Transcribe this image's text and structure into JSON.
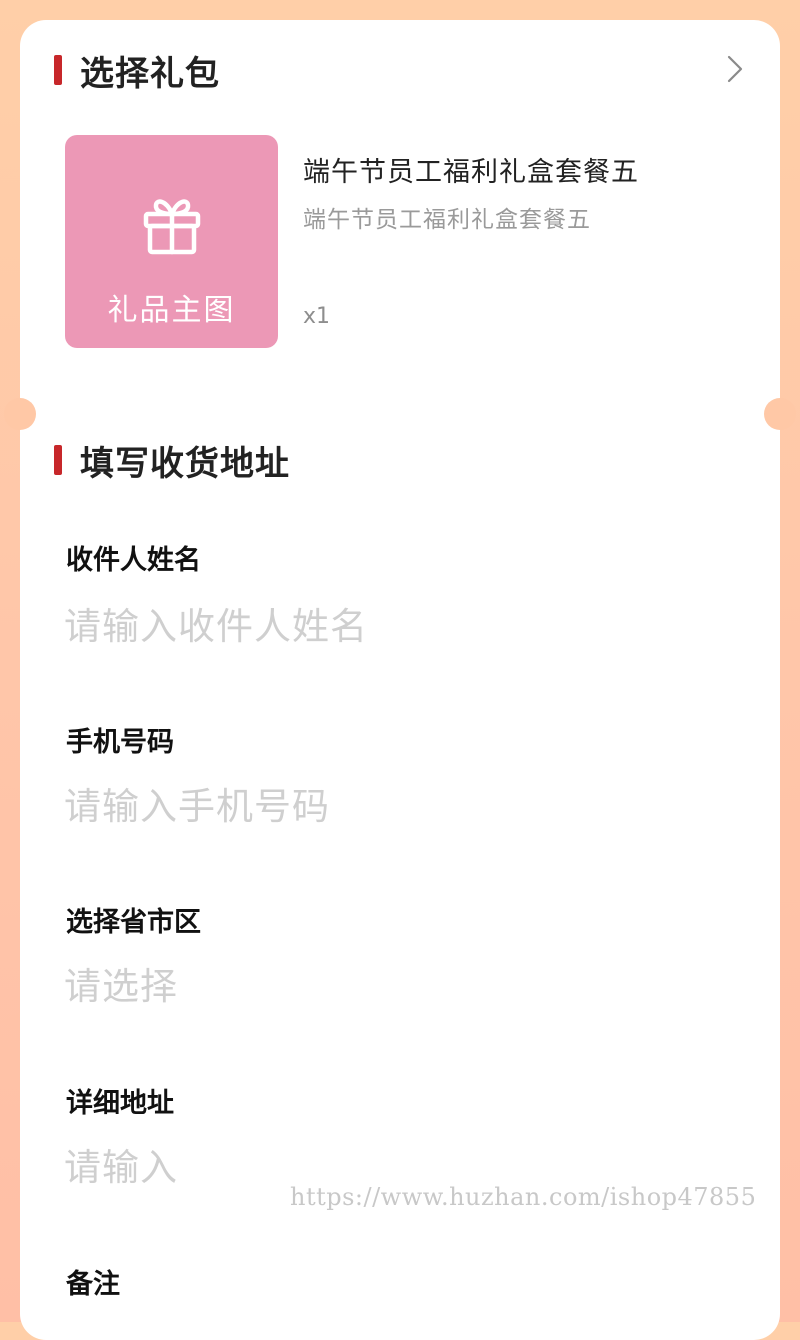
{
  "gift_section": {
    "title": "选择礼包",
    "chevron_icon": "chevron-right-icon",
    "image_label": "礼品主图",
    "image_icon": "gift-icon",
    "image_bg": "#ec98b6",
    "name": "端午节员工福利礼盒套餐五",
    "subtitle": "端午节员工福利礼盒套餐五",
    "quantity": "x1"
  },
  "address_section": {
    "title": "填写收货地址",
    "fields": [
      {
        "label": "收件人姓名",
        "placeholder": "请输入收件人姓名"
      },
      {
        "label": "手机号码",
        "placeholder": "请输入手机号码"
      },
      {
        "label": "选择省市区",
        "placeholder": "请选择"
      },
      {
        "label": "详细地址",
        "placeholder": "请输入"
      },
      {
        "label": "备注",
        "placeholder": ""
      }
    ]
  },
  "watermark": "https://www.huzhan.com/ishop47855",
  "colors": {
    "accent": "#c7272a",
    "background": "#ffcfa8",
    "placeholder": "#cfcfcf"
  }
}
